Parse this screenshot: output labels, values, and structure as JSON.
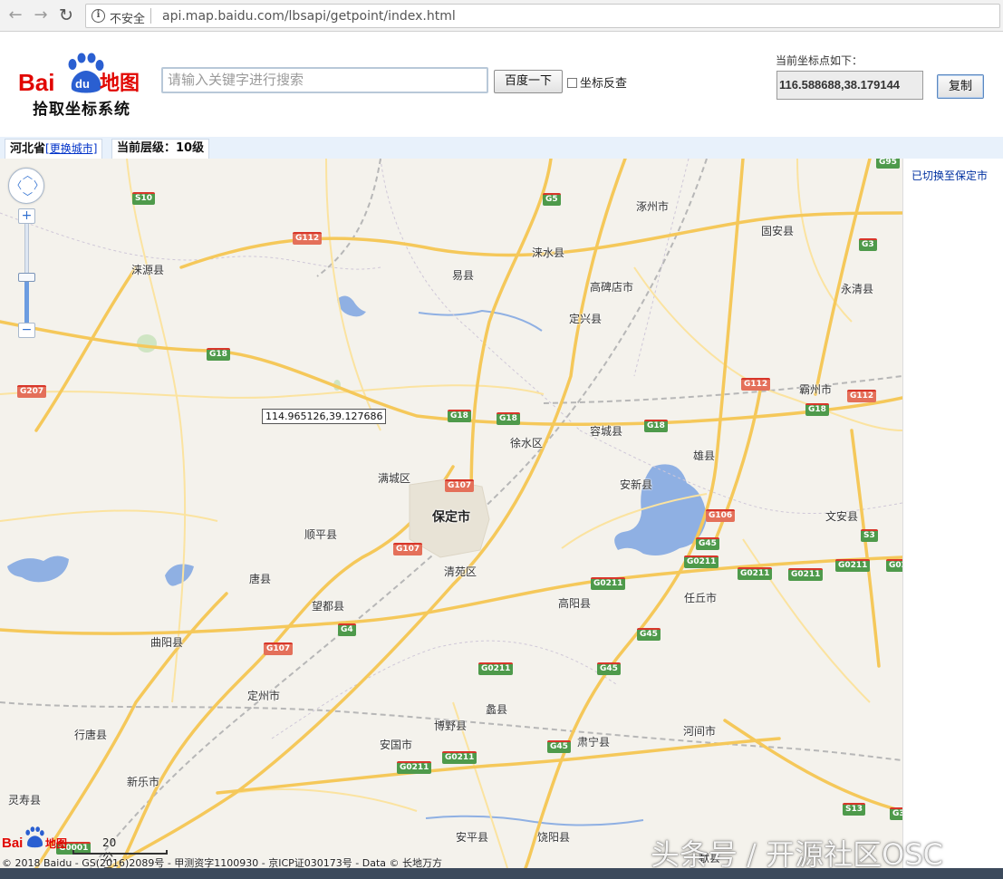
{
  "browser": {
    "insecure_label": "不安全",
    "url": "api.map.baidu.com/lbsapi/getpoint/index.html"
  },
  "header": {
    "logo_bai": "Bai",
    "logo_du": "du",
    "logo_ditu": "地图",
    "subtitle": "拾取坐标系统",
    "search_placeholder": "请输入关键字进行搜索",
    "search_button": "百度一下",
    "reverse_label": "坐标反查",
    "coord_label": "当前坐标点如下：",
    "coord_value": "116.588688,38.179144",
    "copy_button": "复制"
  },
  "levelbar": {
    "province": "河北省",
    "change_city": "[更换城市]",
    "level_text": "当前层级：10级"
  },
  "sidebar": {
    "message": "已切换至保定市"
  },
  "map": {
    "tooltip": "114.965126,39.127686",
    "scale_label": "20 公里",
    "copyright": "© 2018 Baidu - GS(2016)2089号 - 甲测资字1100930 - 京ICP证030173号 - Data © 长地万方",
    "places": [
      "涿州市",
      "固安县",
      "涞水县",
      "涞源县",
      "易县",
      "高碑店市",
      "永清县",
      "定兴县",
      "霸州市",
      "容城县",
      "徐水区",
      "雄县",
      "满城区",
      "安新县",
      "保定市",
      "文安县",
      "顺平县",
      "唐县",
      "清苑区",
      "高阳县",
      "任丘市",
      "望都县",
      "曲阳县",
      "定州市",
      "蠡县",
      "博野县",
      "河间市",
      "行唐县",
      "安国市",
      "肃宁县",
      "新乐市",
      "灵寿县",
      "安平县",
      "饶阳县",
      "献县"
    ],
    "shields": [
      "G95",
      "S10",
      "G5",
      "G112",
      "G3",
      "G18",
      "G207",
      "G112",
      "G112",
      "G18",
      "G18",
      "G18",
      "G18",
      "G107",
      "G106",
      "G107",
      "S3",
      "G45",
      "G0211",
      "G0211",
      "G0211",
      "G0211",
      "G0211",
      "G02",
      "G0211",
      "G4",
      "G107",
      "G45",
      "G45",
      "G0211",
      "G45",
      "G0211",
      "G0211",
      "S13",
      "G3",
      "G0001"
    ]
  },
  "watermark": "头条号 / 开源社区OSC",
  "colors": {
    "brand_red": "#e10601",
    "map_bg": "#f4f2ec",
    "road_yellow": "#f5c85a",
    "water_blue": "#8fb0e3",
    "highway_green": "#4e9a4b",
    "link_blue": "#0032c8"
  }
}
